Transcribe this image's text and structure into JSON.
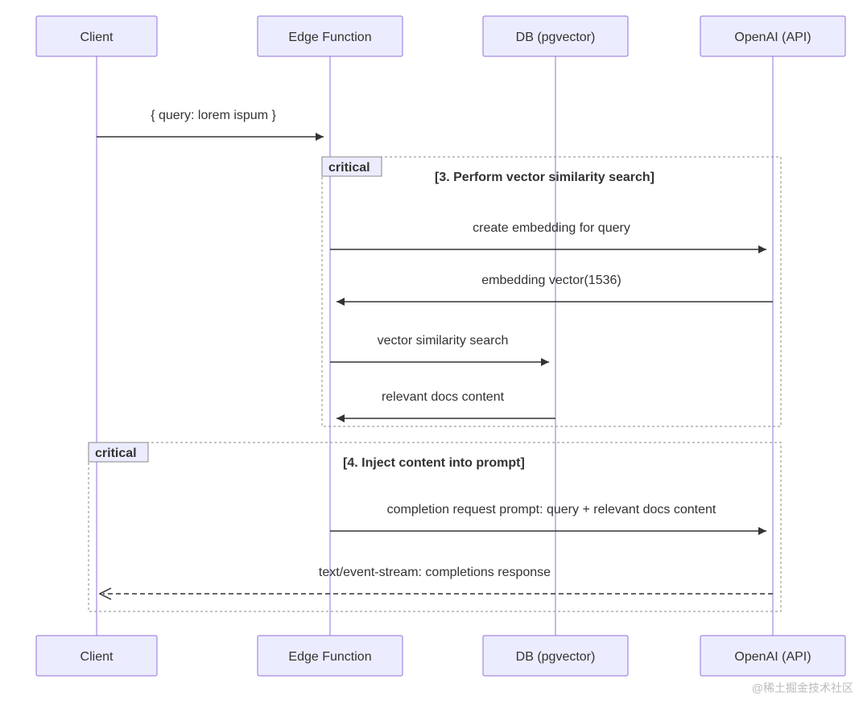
{
  "actors": {
    "client": "Client",
    "edge": "Edge Function",
    "db": "DB (pgvector)",
    "openai": "OpenAI (API)"
  },
  "messages": {
    "m1": "{ query: lorem ispum }",
    "m2": "create embedding for query",
    "m3": "embedding vector(1536)",
    "m4": "vector similarity search",
    "m5": "relevant docs content",
    "m6": "completion request prompt: query + relevant docs content",
    "m7": "text/event-stream: completions response"
  },
  "boxes": {
    "crit_label": "critical",
    "crit1_title": "[3. Perform vector similarity search]",
    "crit2_title": "[4. Inject content into prompt]"
  },
  "watermark": "@稀土掘金技术社区"
}
